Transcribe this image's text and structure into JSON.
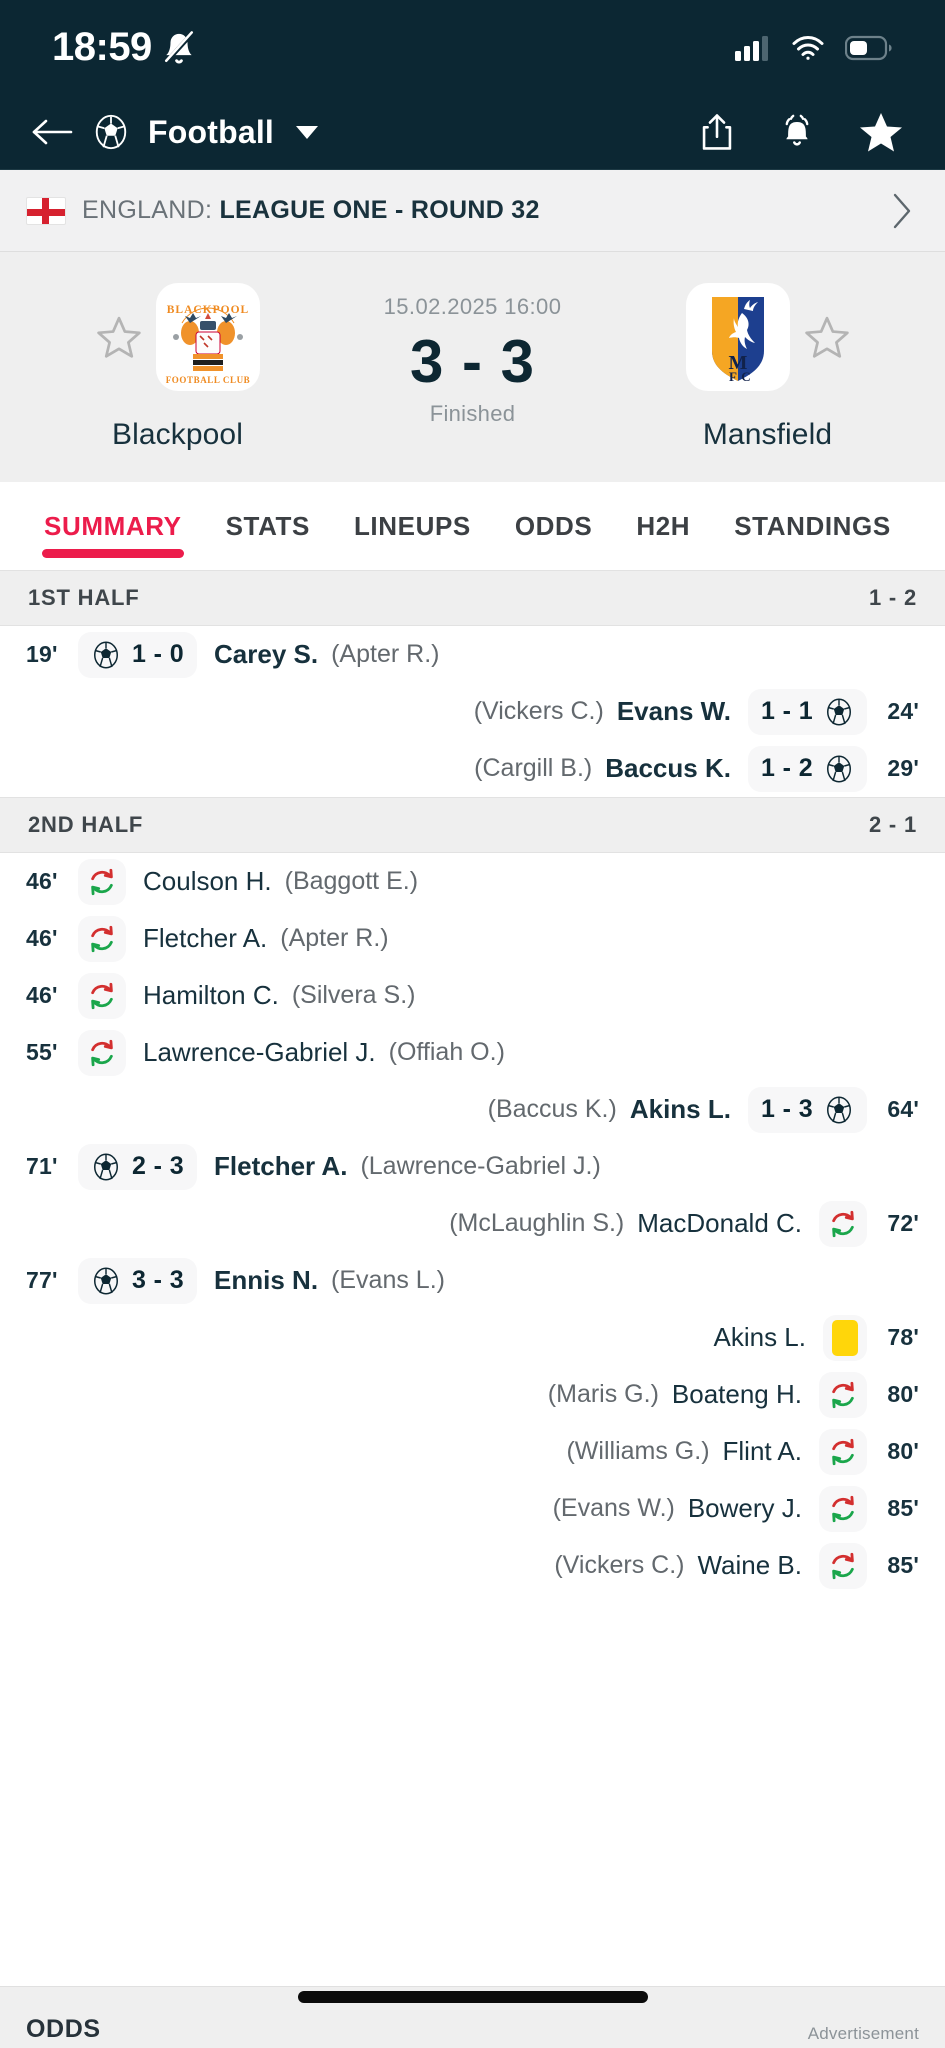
{
  "status_bar": {
    "time": "18:59",
    "mute_icon": "bell-slash-icon",
    "signal_icon": "cellular-signal-icon",
    "wifi_icon": "wifi-icon",
    "battery_icon": "battery-icon"
  },
  "nav": {
    "back_icon": "back-arrow-icon",
    "sport_icon": "football-icon",
    "title": "Football",
    "dropdown_icon": "chevron-down-icon",
    "share_icon": "share-icon",
    "notification_icon": "bell-icon",
    "favorite_icon": "star-filled-icon"
  },
  "league": {
    "flag_icon": "england-flag-icon",
    "country": "ENGLAND:",
    "name": "LEAGUE ONE - ROUND 32",
    "chevron": "›"
  },
  "match": {
    "kickoff": "15.02.2025 16:00",
    "score": "3 - 3",
    "status": "Finished",
    "home": {
      "name": "Blackpool",
      "star_icon": "star-outline-icon",
      "badge_icon": "blackpool-crest"
    },
    "away": {
      "name": "Mansfield",
      "star_icon": "star-outline-icon",
      "badge_icon": "mansfield-crest"
    }
  },
  "tabs": [
    {
      "label": "SUMMARY",
      "active": true
    },
    {
      "label": "STATS",
      "active": false
    },
    {
      "label": "LINEUPS",
      "active": false
    },
    {
      "label": "ODDS",
      "active": false
    },
    {
      "label": "H2H",
      "active": false
    },
    {
      "label": "STANDINGS",
      "active": false
    }
  ],
  "sections": [
    {
      "title": "1ST HALF",
      "score": "1 - 2",
      "events": [
        {
          "side": "home",
          "minute": "19'",
          "icon": "goal-ball-icon",
          "chip_score": "1 - 0",
          "player": "Carey S.",
          "assist": "(Apter R.)",
          "type": "goal"
        },
        {
          "side": "away",
          "minute": "24'",
          "icon": "goal-ball-icon",
          "chip_score": "1 - 1",
          "player": "Evans W.",
          "assist": "(Vickers C.)",
          "type": "goal"
        },
        {
          "side": "away",
          "minute": "29'",
          "icon": "goal-ball-icon",
          "chip_score": "1 - 2",
          "player": "Baccus K.",
          "assist": "(Cargill B.)",
          "type": "goal"
        }
      ]
    },
    {
      "title": "2ND HALF",
      "score": "2 - 1",
      "events": [
        {
          "side": "home",
          "minute": "46'",
          "icon": "substitution-icon",
          "chip_score": "",
          "player": "Coulson H.",
          "assist": "(Baggott E.)",
          "type": "sub"
        },
        {
          "side": "home",
          "minute": "46'",
          "icon": "substitution-icon",
          "chip_score": "",
          "player": "Fletcher A.",
          "assist": "(Apter R.)",
          "type": "sub"
        },
        {
          "side": "home",
          "minute": "46'",
          "icon": "substitution-icon",
          "chip_score": "",
          "player": "Hamilton C.",
          "assist": "(Silvera S.)",
          "type": "sub"
        },
        {
          "side": "home",
          "minute": "55'",
          "icon": "substitution-icon",
          "chip_score": "",
          "player": "Lawrence-Gabriel J.",
          "assist": "(Offiah O.)",
          "type": "sub"
        },
        {
          "side": "away",
          "minute": "64'",
          "icon": "goal-ball-icon",
          "chip_score": "1 - 3",
          "player": "Akins L.",
          "assist": "(Baccus K.)",
          "type": "goal"
        },
        {
          "side": "home",
          "minute": "71'",
          "icon": "goal-ball-icon",
          "chip_score": "2 - 3",
          "player": "Fletcher A.",
          "assist": "(Lawrence-Gabriel J.)",
          "type": "goal"
        },
        {
          "side": "away",
          "minute": "72'",
          "icon": "substitution-icon",
          "chip_score": "",
          "player": "MacDonald C.",
          "assist": "(McLaughlin S.)",
          "type": "sub"
        },
        {
          "side": "home",
          "minute": "77'",
          "icon": "goal-ball-icon",
          "chip_score": "3 - 3",
          "player": "Ennis N.",
          "assist": "(Evans L.)",
          "type": "goal"
        },
        {
          "side": "away",
          "minute": "78'",
          "icon": "yellow-card-icon",
          "chip_score": "",
          "player": "Akins L.",
          "assist": "",
          "type": "card"
        },
        {
          "side": "away",
          "minute": "80'",
          "icon": "substitution-icon",
          "chip_score": "",
          "player": "Boateng H.",
          "assist": "(Maris G.)",
          "type": "sub"
        },
        {
          "side": "away",
          "minute": "80'",
          "icon": "substitution-icon",
          "chip_score": "",
          "player": "Flint A.",
          "assist": "(Williams G.)",
          "type": "sub"
        },
        {
          "side": "away",
          "minute": "85'",
          "icon": "substitution-icon",
          "chip_score": "",
          "player": "Bowery J.",
          "assist": "(Evans W.)",
          "type": "sub"
        },
        {
          "side": "away",
          "minute": "85'",
          "icon": "substitution-icon",
          "chip_score": "",
          "player": "Waine B.",
          "assist": "(Vickers C.)",
          "type": "sub"
        }
      ]
    }
  ],
  "footer": {
    "odds_label": "ODDS",
    "advertisement_label": "Advertisement"
  },
  "colors": {
    "header_bg": "#0c2733",
    "accent": "#ec1c4b",
    "yellow_card": "#ffd60a",
    "sub_in": "#1aa64b",
    "sub_out": "#d32f2f"
  }
}
